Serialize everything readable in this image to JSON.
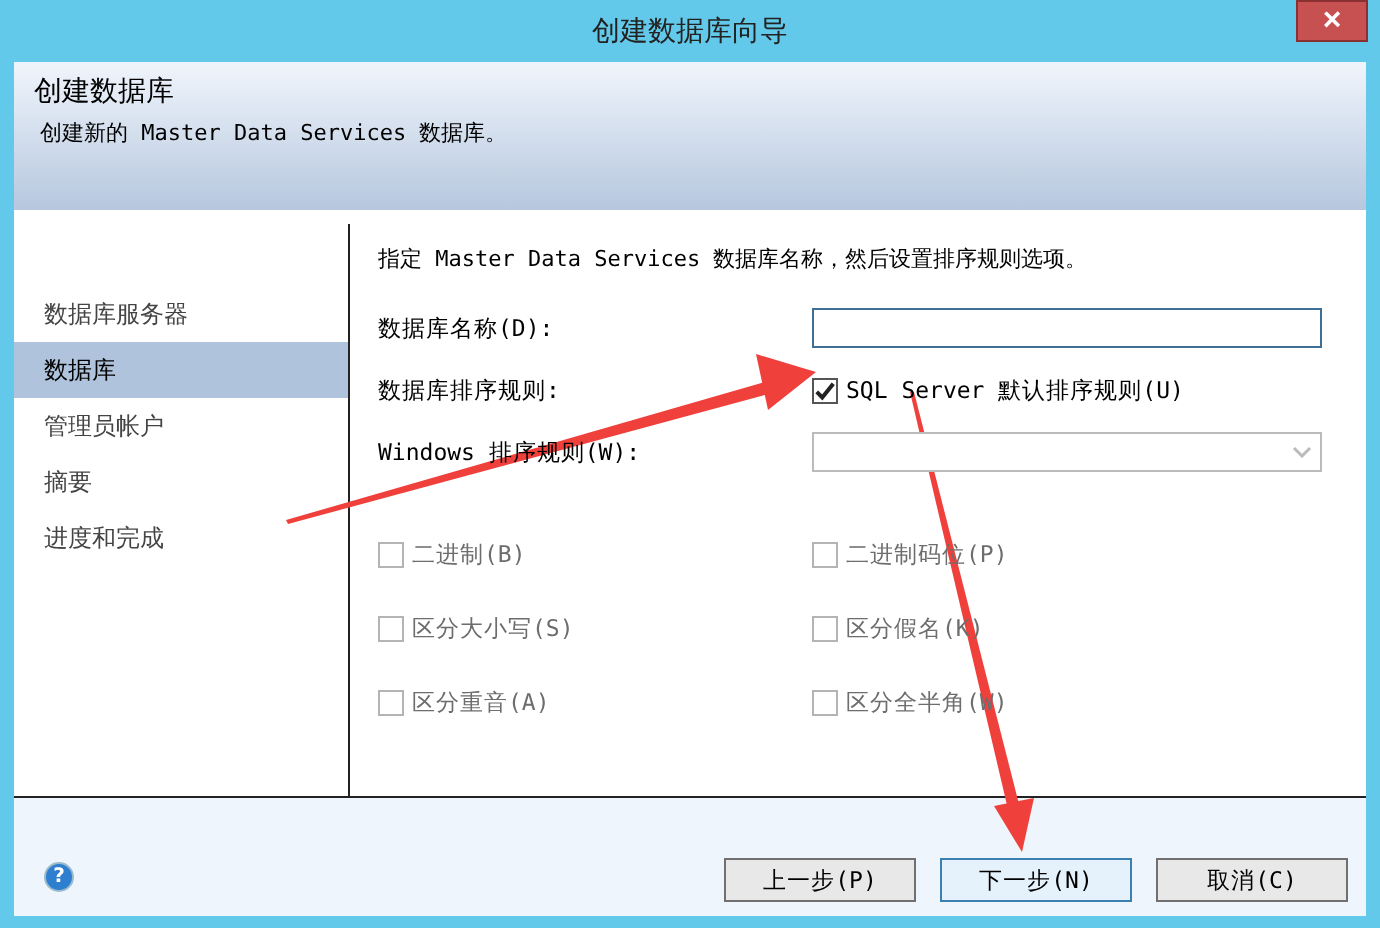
{
  "window": {
    "title": "创建数据库向导",
    "close": "×"
  },
  "header": {
    "title": "创建数据库",
    "subtitle": "创建新的 Master Data Services 数据库。"
  },
  "sidebar": {
    "items": [
      {
        "label": "数据库服务器",
        "selected": false
      },
      {
        "label": "数据库",
        "selected": true
      },
      {
        "label": "管理员帐户",
        "selected": false
      },
      {
        "label": "摘要",
        "selected": false
      },
      {
        "label": "进度和完成",
        "selected": false
      }
    ]
  },
  "content": {
    "instruction": "指定 Master Data Services 数据库名称，然后设置排序规则选项。",
    "name_label": "数据库名称(D):",
    "collation_label": "数据库排序规则:",
    "sql_default": {
      "label": "SQL Server 默认排序规则(U)",
      "checked": true
    },
    "windows_label": "Windows 排序规则(W):",
    "windows_dropdown": {
      "disabled": true
    },
    "options": [
      {
        "label": "二进制(B)",
        "checked": false,
        "disabled": true
      },
      {
        "label": "二进制码位(P)",
        "checked": false,
        "disabled": true
      },
      {
        "label": "区分大小写(S)",
        "checked": false,
        "disabled": true
      },
      {
        "label": "区分假名(K)",
        "checked": false,
        "disabled": true
      },
      {
        "label": "区分重音(A)",
        "checked": false,
        "disabled": true
      },
      {
        "label": "区分全半角(W)",
        "checked": false,
        "disabled": true
      }
    ]
  },
  "buttons": [
    {
      "label": "上一步(P)",
      "focused": false
    },
    {
      "label": "下一步(N)",
      "focused": true
    },
    {
      "label": "取消(C)",
      "focused": false
    }
  ],
  "help": "?"
}
